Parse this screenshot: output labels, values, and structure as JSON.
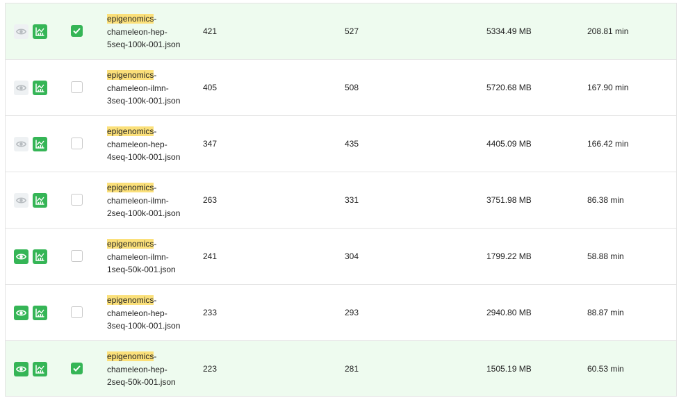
{
  "rows": [
    {
      "name_prefix": "epigenomics",
      "name_dash": "-",
      "name_line2": "chameleon-hep-",
      "name_line3": "5seq-100k-001.json",
      "jobs": "421",
      "files": "527",
      "size": "5334.49 MB",
      "time": "208.81 min",
      "checked": true,
      "view_enabled": false
    },
    {
      "name_prefix": "epigenomics",
      "name_dash": "-",
      "name_line2": "chameleon-ilmn-",
      "name_line3": "3seq-100k-001.json",
      "jobs": "405",
      "files": "508",
      "size": "5720.68 MB",
      "time": "167.90 min",
      "checked": false,
      "view_enabled": false
    },
    {
      "name_prefix": "epigenomics",
      "name_dash": "-",
      "name_line2": "chameleon-hep-",
      "name_line3": "4seq-100k-001.json",
      "jobs": "347",
      "files": "435",
      "size": "4405.09 MB",
      "time": "166.42 min",
      "checked": false,
      "view_enabled": false
    },
    {
      "name_prefix": "epigenomics",
      "name_dash": "-",
      "name_line2": "chameleon-ilmn-",
      "name_line3": "2seq-100k-001.json",
      "jobs": "263",
      "files": "331",
      "size": "3751.98 MB",
      "time": "86.38 min",
      "checked": false,
      "view_enabled": false
    },
    {
      "name_prefix": "epigenomics",
      "name_dash": "-",
      "name_line2": "chameleon-ilmn-",
      "name_line3": "1seq-50k-001.json",
      "jobs": "241",
      "files": "304",
      "size": "1799.22 MB",
      "time": "58.88 min",
      "checked": false,
      "view_enabled": true
    },
    {
      "name_prefix": "epigenomics",
      "name_dash": "-",
      "name_line2": "chameleon-hep-",
      "name_line3": "3seq-100k-001.json",
      "jobs": "233",
      "files": "293",
      "size": "2940.80 MB",
      "time": "88.87 min",
      "checked": false,
      "view_enabled": true
    },
    {
      "name_prefix": "epigenomics",
      "name_dash": "-",
      "name_line2": "chameleon-hep-",
      "name_line3": "2seq-50k-001.json",
      "jobs": "223",
      "files": "281",
      "size": "1505.19 MB",
      "time": "60.53 min",
      "checked": true,
      "view_enabled": true
    }
  ],
  "icons": {
    "view": "eye-icon",
    "chart": "chart-icon",
    "check": "check-icon"
  },
  "colors": {
    "accent": "#35b556",
    "highlight": "#fbe07a",
    "selected_row": "#eefbef",
    "disabled_button": "#eef1f3"
  }
}
